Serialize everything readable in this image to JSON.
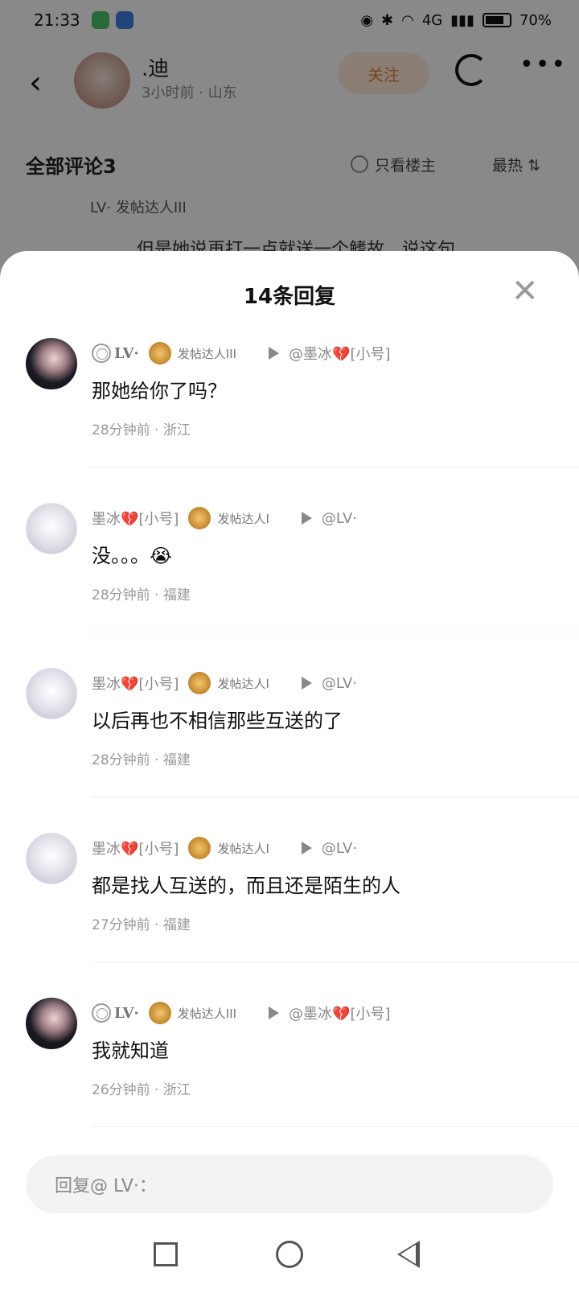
{
  "status_bar": {
    "time": "21:33",
    "battery": "70%",
    "network": "4G"
  },
  "post_header": {
    "author": ".迪",
    "meta": "3小时前 · 山东",
    "follow_label": "关注"
  },
  "comments_bar": {
    "title": "全部评论3",
    "only_op": "只看楼主",
    "sort": "最热"
  },
  "background_peek": {
    "user": "LV·",
    "badge": "发帖达人III",
    "text": "但是她说再打一点就送一个鳍故，说这句"
  },
  "sheet": {
    "title": "14条回复"
  },
  "replies": [
    {
      "avatar": "dark",
      "user": "LV·",
      "user_has_web_icon": true,
      "badge": "发帖达人III",
      "to": "@墨冰💔[小号]",
      "text": "那她给你了吗？",
      "time_loc": "28分钟前 · 浙江"
    },
    {
      "avatar": "light",
      "user": "墨冰💔[小号]",
      "user_has_web_icon": false,
      "badge": "发帖达人I",
      "to": "@LV·",
      "text": "没。。。😭",
      "time_loc": "28分钟前 · 福建"
    },
    {
      "avatar": "light",
      "user": "墨冰💔[小号]",
      "user_has_web_icon": false,
      "badge": "发帖达人I",
      "to": "@LV·",
      "text": "以后再也不相信那些互送的了",
      "time_loc": "28分钟前 · 福建"
    },
    {
      "avatar": "light",
      "user": "墨冰💔[小号]",
      "user_has_web_icon": false,
      "badge": "发帖达人I",
      "to": "@LV·",
      "text": "都是找人互送的，而且还是陌生的人",
      "time_loc": "27分钟前 · 福建"
    },
    {
      "avatar": "dark",
      "user": "LV·",
      "user_has_web_icon": true,
      "badge": "发帖达人III",
      "to": "@墨冰💔[小号]",
      "text": "我就知道",
      "time_loc": "26分钟前 · 浙江"
    }
  ],
  "reply_input": {
    "placeholder": "回复@ LV·："
  },
  "nav_bar": {
    "icons": [
      "square-icon",
      "circle-icon",
      "back-triangle-icon"
    ]
  }
}
